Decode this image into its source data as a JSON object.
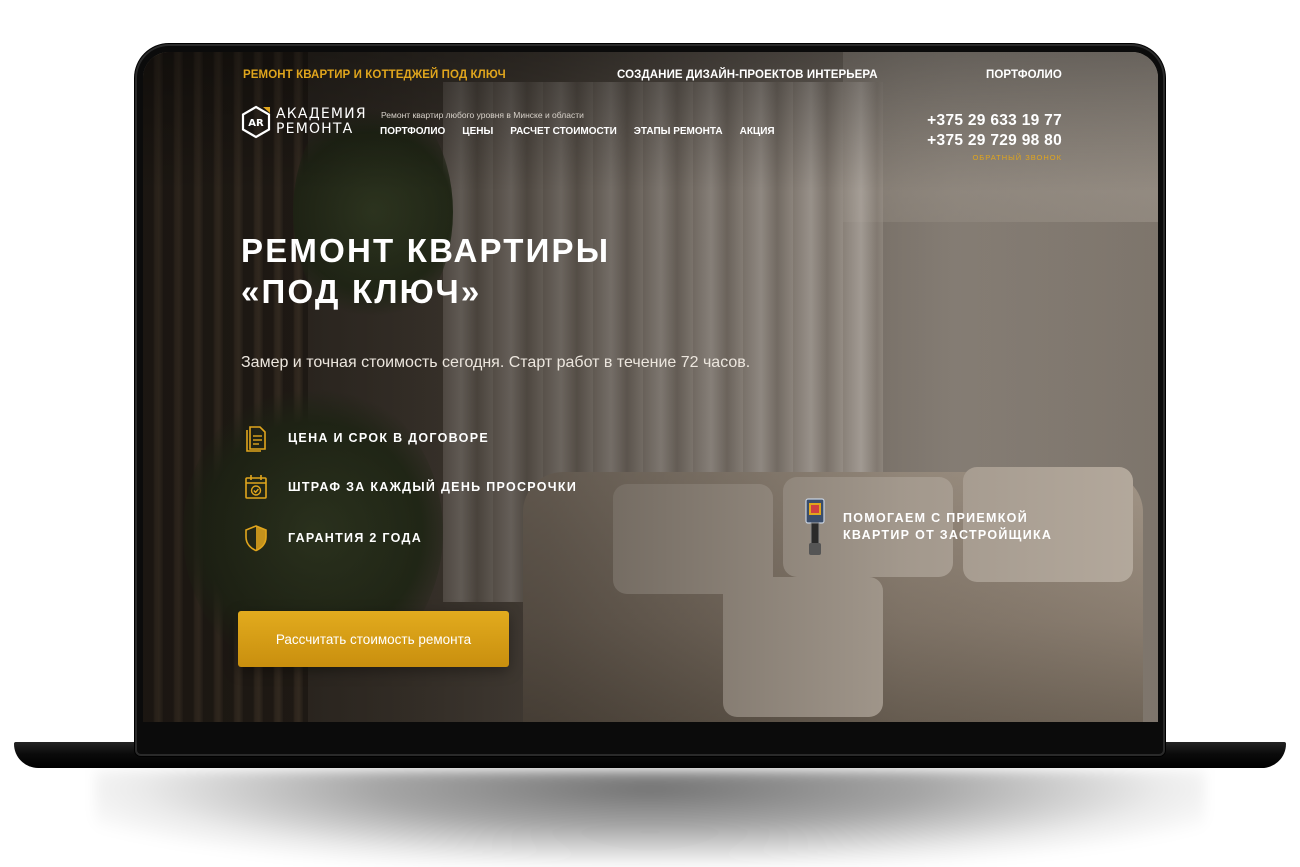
{
  "colors": {
    "accent": "#e0a51d",
    "button_gradient_top": "#e2ab1e",
    "button_gradient_bottom": "#c98f0e",
    "text": "#ffffff"
  },
  "topbar": {
    "items": [
      {
        "label": "РЕМОНТ КВАРТИР И КОТТЕДЖЕЙ ПОД КЛЮЧ",
        "style": "accent"
      },
      {
        "label": "СОЗДАНИЕ ДИЗАЙН-ПРОЕКТОВ ИНТЕРЬЕРА",
        "style": "white"
      },
      {
        "label": "ПОРТФОЛИО",
        "style": "white"
      }
    ]
  },
  "header": {
    "logo_text": "АКАДЕМИЯ\nРЕМОНТА",
    "logo_mark": "AR",
    "tagline": "Ремонт квартир любого уровня в Минске и области",
    "nav": [
      "ПОРТФОЛИО",
      "ЦЕНЫ",
      "РАСЧЕТ СТОИМОСТИ",
      "ЭТАПЫ РЕМОНТА",
      "АКЦИЯ"
    ],
    "phones": [
      "+375 29 633 19 77",
      "+375 29 729 98 80"
    ],
    "callback_label": "ОБРАТНЫЙ ЗВОНОК"
  },
  "hero": {
    "title": "РЕМОНТ КВАРТИРЫ\n«ПОД КЛЮЧ»",
    "subtitle": "Замер и точная стоимость сегодня. Старт работ в течение 72 часов.",
    "features": [
      {
        "icon": "contract-icon",
        "label": "ЦЕНА И СРОК В ДОГОВОРЕ"
      },
      {
        "icon": "calendar-icon",
        "label": "ШТРАФ ЗА КАЖДЫЙ ДЕНЬ ПРОСРОЧКИ"
      },
      {
        "icon": "shield-icon",
        "label": "ГАРАНТИЯ 2 ГОДА"
      }
    ],
    "cta_label": "Рассчитать стоимость ремонта",
    "acceptance_icon": "thermal-imager-icon",
    "acceptance_text": "ПОМОГАЕМ С ПРИЕМКОЙ\nКВАРТИР ОТ ЗАСТРОЙЩИКА"
  }
}
